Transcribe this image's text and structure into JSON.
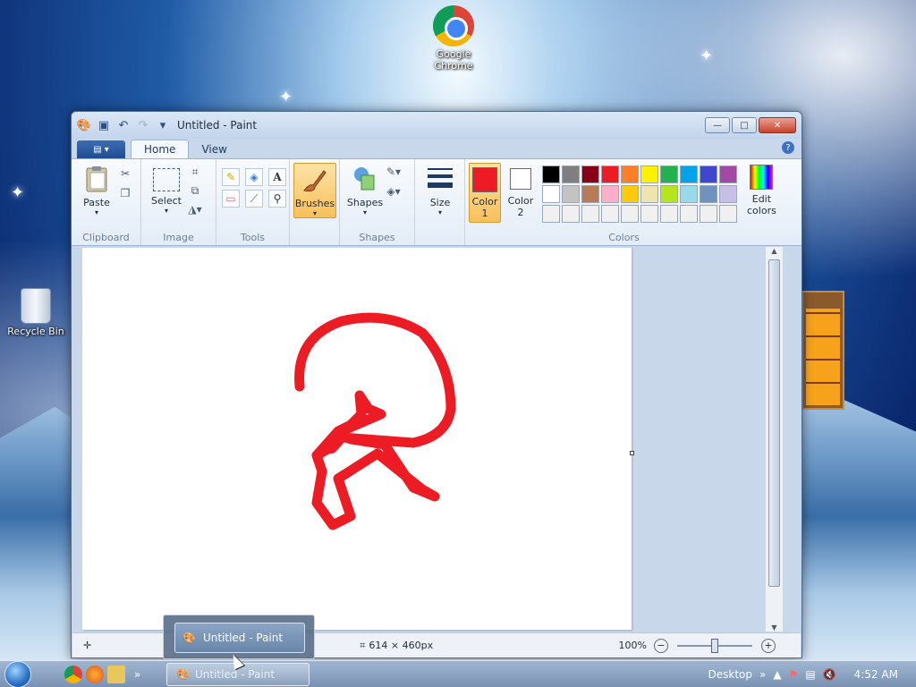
{
  "desktop": {
    "icons": [
      {
        "label_line1": "Google",
        "label_line2": "Chrome"
      },
      {
        "label_line1": "Recycle Bin",
        "label_line2": ""
      }
    ]
  },
  "window": {
    "title": "Untitled - Paint",
    "tabs": [
      "Home",
      "View"
    ],
    "help_glyph": "?",
    "close_glyph": "✕",
    "maximize_glyph": "□",
    "minimize_glyph": "—"
  },
  "ribbon": {
    "clipboard": {
      "paste": "Paste",
      "group": "Clipboard"
    },
    "image": {
      "select": "Select",
      "group": "Image"
    },
    "tools": {
      "group": "Tools",
      "text_glyph": "A"
    },
    "brushes": {
      "label": "Brushes"
    },
    "shapes": {
      "label": "Shapes",
      "group": "Shapes"
    },
    "size": {
      "label": "Size"
    },
    "colors": {
      "color1": "Color",
      "color1_num": "1",
      "color2": "Color",
      "color2_num": "2",
      "edit": "Edit",
      "edit2": "colors",
      "group": "Colors",
      "color1_value": "#ed1c24",
      "color2_value": "#ffffff",
      "palette": [
        "#000000",
        "#7f7f7f",
        "#880015",
        "#ed1c24",
        "#ff7f27",
        "#fff200",
        "#22b14c",
        "#00a2e8",
        "#3f48cc",
        "#a349a4",
        "#ffffff",
        "#c3c3c3",
        "#b97a57",
        "#ffaec9",
        "#ffc90e",
        "#efe4b0",
        "#b5e61d",
        "#99d9ea",
        "#7092be",
        "#c8bfe7",
        "#f0f0f0",
        "#f0f0f0",
        "#f0f0f0",
        "#f0f0f0",
        "#f0f0f0",
        "#f0f0f0",
        "#f0f0f0",
        "#f0f0f0",
        "#f0f0f0",
        "#f0f0f0"
      ]
    }
  },
  "canvas": {
    "stroke_color": "#ed1c24"
  },
  "status": {
    "dimensions": "614 × 460px",
    "zoom": "100%"
  },
  "taskbar": {
    "popup_title": "Untitled - Paint",
    "task_title": "Untitled - Paint",
    "desktop_label": "Desktop",
    "clock": "4:52 AM",
    "chevron": "»"
  }
}
